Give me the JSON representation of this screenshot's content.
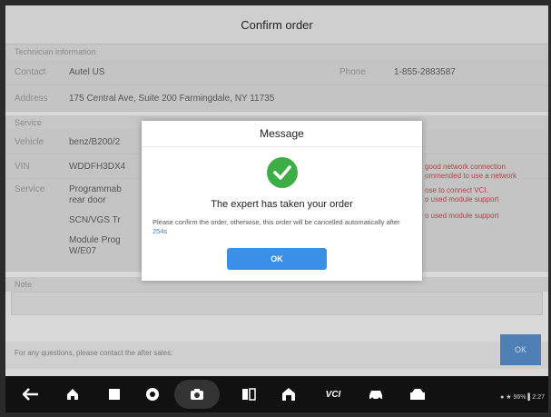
{
  "header": {
    "title": "Confirm order"
  },
  "tech": {
    "section_label": "Technician information",
    "contact_label": "Contact",
    "contact_value": "Autel US",
    "phone_label": "Phone",
    "phone_value": "1-855-2883587",
    "address_label": "Address",
    "address_value": "175 Central Ave, Suite 200 Farmingdale, NY 11735"
  },
  "service": {
    "section_label": "Service",
    "vehicle_label": "Vehicle",
    "vehicle_value": "benz/B200/2",
    "vin_label": "VIN",
    "vin_value": "WDDFH3DX4",
    "service_label": "Service",
    "service_items": [
      "Programmab",
      "rear door",
      "SCN/VGS Tr",
      "Module Prog",
      "W/E07"
    ],
    "notes_right": [
      "good network connection",
      "ommended to use a network",
      "ose to connect VCI.",
      "o used module support",
      "o used module support"
    ]
  },
  "note": {
    "label": "Note"
  },
  "footer": {
    "text": "For any questions, please contact the after sales:",
    "ok_label": "OK"
  },
  "dialog": {
    "title": "Message",
    "icon": "check-circle-icon",
    "main_text": "The expert has taken your order",
    "sub_text": "Please confirm the order, otherwise, this order will be cancelled automatically after ",
    "countdown": "254s",
    "ok_label": "OK"
  },
  "navbar": {
    "items": [
      "back-icon",
      "home-icon",
      "recent-apps-icon",
      "vpn-icon",
      "camera-icon",
      "split-screen-icon",
      "garage-icon",
      "vci-icon",
      "car-icon",
      "workshop-icon"
    ],
    "vci_text": "VCI",
    "status_text": "● ★ 96% ▌2:27"
  },
  "colors": {
    "accent": "#3a8fe7",
    "success": "#3cae45",
    "warning": "#b04444"
  }
}
